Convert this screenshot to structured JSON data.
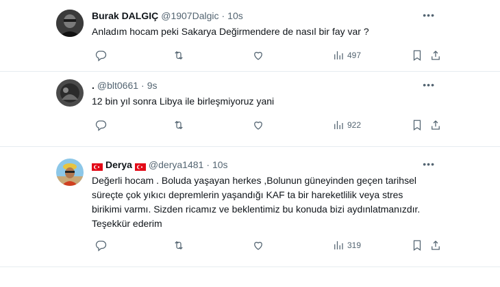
{
  "tweets": [
    {
      "name": "Burak DALGIÇ",
      "handle": "@1907Dalgic",
      "separator": "·",
      "time": "10s",
      "text": "Anladım hocam peki Sakarya Değirmendere de nasıl bir fay var ?",
      "views": "497"
    },
    {
      "name": ".",
      "handle": "@blt0661",
      "separator": "·",
      "time": "9s",
      "text": "12 bin yıl sonra Libya ile birleşmiyoruz yani",
      "views": "922"
    },
    {
      "name": "Derya",
      "handle": "@derya1481",
      "separator": "·",
      "time": "10s",
      "text": "Değerli hocam . Boluda yaşayan herkes ,Bolunun güneyinden geçen tarihsel süreçte çok yıkıcı depremlerin yaşandığı KAF ta bir hareketlilik veya stres birikimi varmı. Sizden ricamız ve beklentimiz bu konuda bizi aydınlatmanızdır. Teşekkür ederim",
      "views": "319"
    }
  ],
  "icons": {
    "reply": "reply-icon",
    "retweet": "retweet-icon",
    "like": "like-icon",
    "views": "views-icon",
    "bookmark": "bookmark-icon",
    "share": "share-icon",
    "more": "more-icon",
    "flag": "turkey-flag-icon"
  },
  "colors": {
    "text": "#0f1419",
    "secondary": "#536471",
    "border": "#e6ecf0",
    "flag": "#e30a17"
  }
}
